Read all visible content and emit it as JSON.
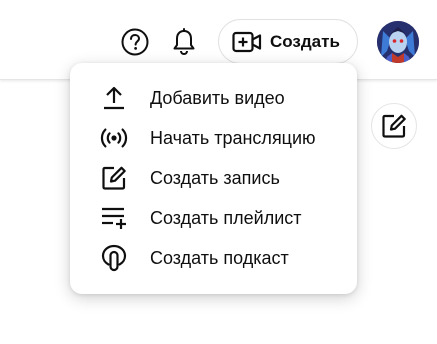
{
  "header": {
    "create_button_label": "Создать",
    "help_icon": "help-circle-icon",
    "notifications_icon": "bell-icon",
    "create_icon": "video-plus-icon"
  },
  "menu": {
    "items": [
      {
        "label": "Добавить видео",
        "icon": "upload-icon"
      },
      {
        "label": "Начать трансляцию",
        "icon": "live-broadcast-icon"
      },
      {
        "label": "Создать запись",
        "icon": "edit-post-icon"
      },
      {
        "label": "Создать плейлист",
        "icon": "playlist-add-icon"
      },
      {
        "label": "Создать подкаст",
        "icon": "podcast-icon"
      }
    ]
  },
  "colors": {
    "text": "#0f0f0f",
    "border": "#e5e5e5",
    "background": "#ffffff"
  }
}
